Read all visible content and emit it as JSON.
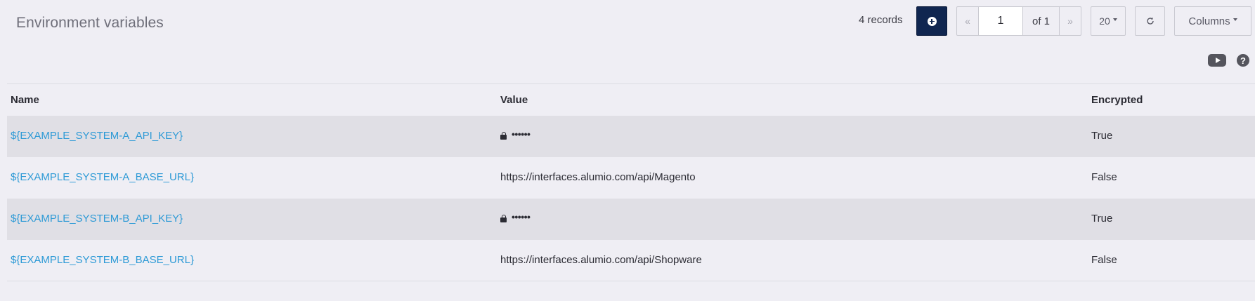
{
  "header": {
    "title": "Environment variables",
    "records_label": "4 records",
    "pagination": {
      "prev_label": "«",
      "current_page": "1",
      "of_label": "of 1",
      "next_label": "»"
    },
    "page_size": "20",
    "columns_label": "Columns"
  },
  "icons": {
    "add": "plus-circle-icon",
    "refresh": "refresh-icon",
    "video": "youtube-icon",
    "help": "question-icon",
    "lock": "lock-icon"
  },
  "table": {
    "columns": [
      "Name",
      "Value",
      "Encrypted"
    ],
    "rows": [
      {
        "name": "${EXAMPLE_SYSTEM-A_API_KEY}",
        "value": "••••••",
        "masked": true,
        "encrypted": "True"
      },
      {
        "name": "${EXAMPLE_SYSTEM-A_BASE_URL}",
        "value": "https://interfaces.alumio.com/api/Magento",
        "masked": false,
        "encrypted": "False"
      },
      {
        "name": "${EXAMPLE_SYSTEM-B_API_KEY}",
        "value": "••••••",
        "masked": true,
        "encrypted": "True"
      },
      {
        "name": "${EXAMPLE_SYSTEM-B_BASE_URL}",
        "value": "https://interfaces.alumio.com/api/Shopware",
        "masked": false,
        "encrypted": "False"
      }
    ]
  },
  "colors": {
    "background": "#efeef4",
    "primary_button": "#102650",
    "link": "#2d9ad6",
    "row_shade": "#e0dfe5"
  }
}
